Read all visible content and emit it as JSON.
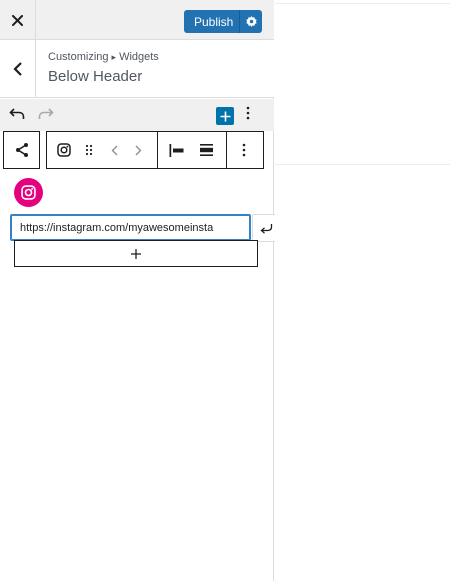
{
  "header": {
    "close_icon": "close-icon",
    "publish_label": "Publish",
    "settings_icon": "gear-icon"
  },
  "section": {
    "breadcrumb_root": "Customizing",
    "breadcrumb_sep_icon": "triangle-right-icon",
    "breadcrumb_current": "Widgets",
    "title": "Below Header"
  },
  "editor_toolbar": {
    "undo_icon": "undo-icon",
    "redo_icon": "redo-icon",
    "inserter_icon": "plus-icon",
    "options_icon": "more-vertical-icon"
  },
  "block_toolbar": {
    "parent_icon": "share-icon",
    "block_icon": "instagram-icon",
    "drag_icon": "drag-handle-icon",
    "move_prev_icon": "chevron-left-icon",
    "move_next_icon": "chevron-right-icon",
    "justify_icon": "justify-left-icon",
    "align_icon": "align-center-icon",
    "options_icon": "more-vertical-icon"
  },
  "social_link": {
    "service_icon": "instagram-icon",
    "brand_color": "#e4007f",
    "url_value": "https://instagram.com/myawesomeinsta",
    "apply_icon": "enter-icon"
  },
  "appender": {
    "icon": "plus-icon"
  },
  "colors": {
    "primary": "#2271b1",
    "inserter": "#0073aa",
    "panel_bg": "#f0f0f1",
    "text": "#1e1e1e"
  }
}
